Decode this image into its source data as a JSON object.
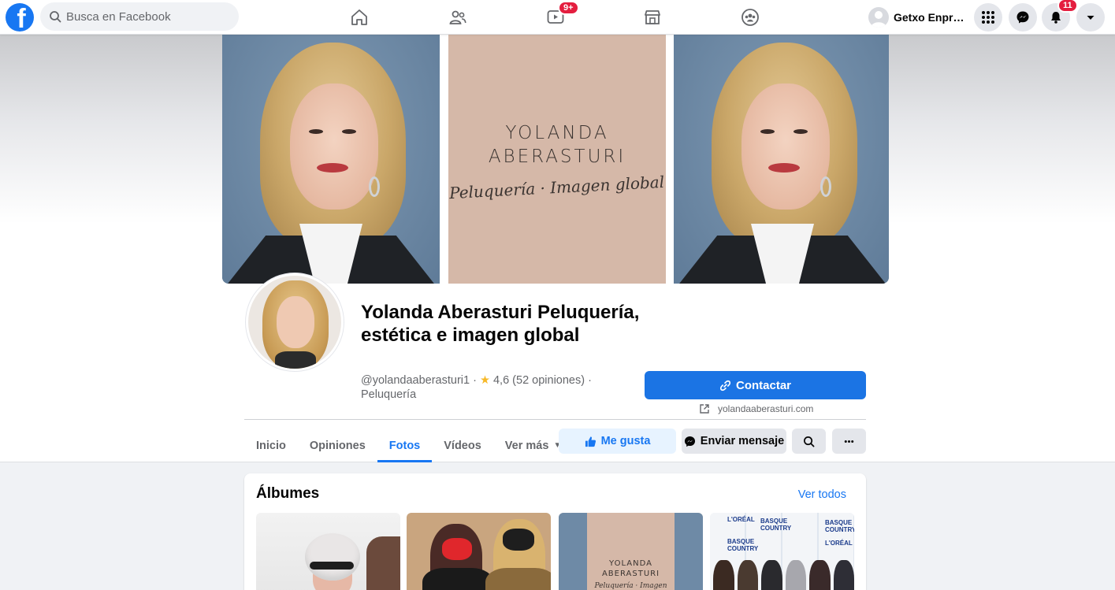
{
  "topbar": {
    "logo_letter": "f",
    "search_placeholder": "Busca en Facebook",
    "nav_icons": [
      "home-icon",
      "friends-icon",
      "watch-icon",
      "marketplace-icon",
      "groups-icon"
    ],
    "watch_badge": "9+",
    "profile_name": "Getxo Enpr…",
    "menu_icon": "menu-grid-icon",
    "messenger_icon": "messenger-icon",
    "notifications_badge": "11",
    "account_icon": "caret-down-icon"
  },
  "cover": {
    "brand_line1": "YOLANDA",
    "brand_line2": "ABERASTURI",
    "brand_script": "Peluquería · Imagen global"
  },
  "page": {
    "name": "Yolanda Aberasturi Peluquería, estética e imagen global",
    "handle": "@yolandaaberasturi1",
    "rating_star": "★",
    "rating": "4,6 (52 opiniones)",
    "category": "Peluquería",
    "contact_button": "Contactar",
    "website": "yolandaaberasturi.com"
  },
  "tabs": [
    {
      "label": "Inicio",
      "active": false
    },
    {
      "label": "Opiniones",
      "active": false
    },
    {
      "label": "Fotos",
      "active": true
    },
    {
      "label": "Vídeos",
      "active": false
    },
    {
      "label": "Ver más",
      "active": false
    }
  ],
  "actions": {
    "like": "Me gusta",
    "message": "Enviar mensaje"
  },
  "albums": {
    "title": "Álbumes",
    "see_all": "Ver todos",
    "album3_line1": "YOLANDA",
    "album3_line2": "ABERASTURI",
    "album3_script": "Peluquería · Imagen global",
    "album4_logos": [
      "L'ORÉAL",
      "BASQUE COUNTRY",
      "BASQUE COUNTRY",
      "L'ORÉAL",
      "BASQUE COUNTRY"
    ]
  },
  "colors": {
    "brand_blue": "#1877f2",
    "badge_red": "#e41e3f",
    "cover_taupe": "#d5b8a8"
  }
}
